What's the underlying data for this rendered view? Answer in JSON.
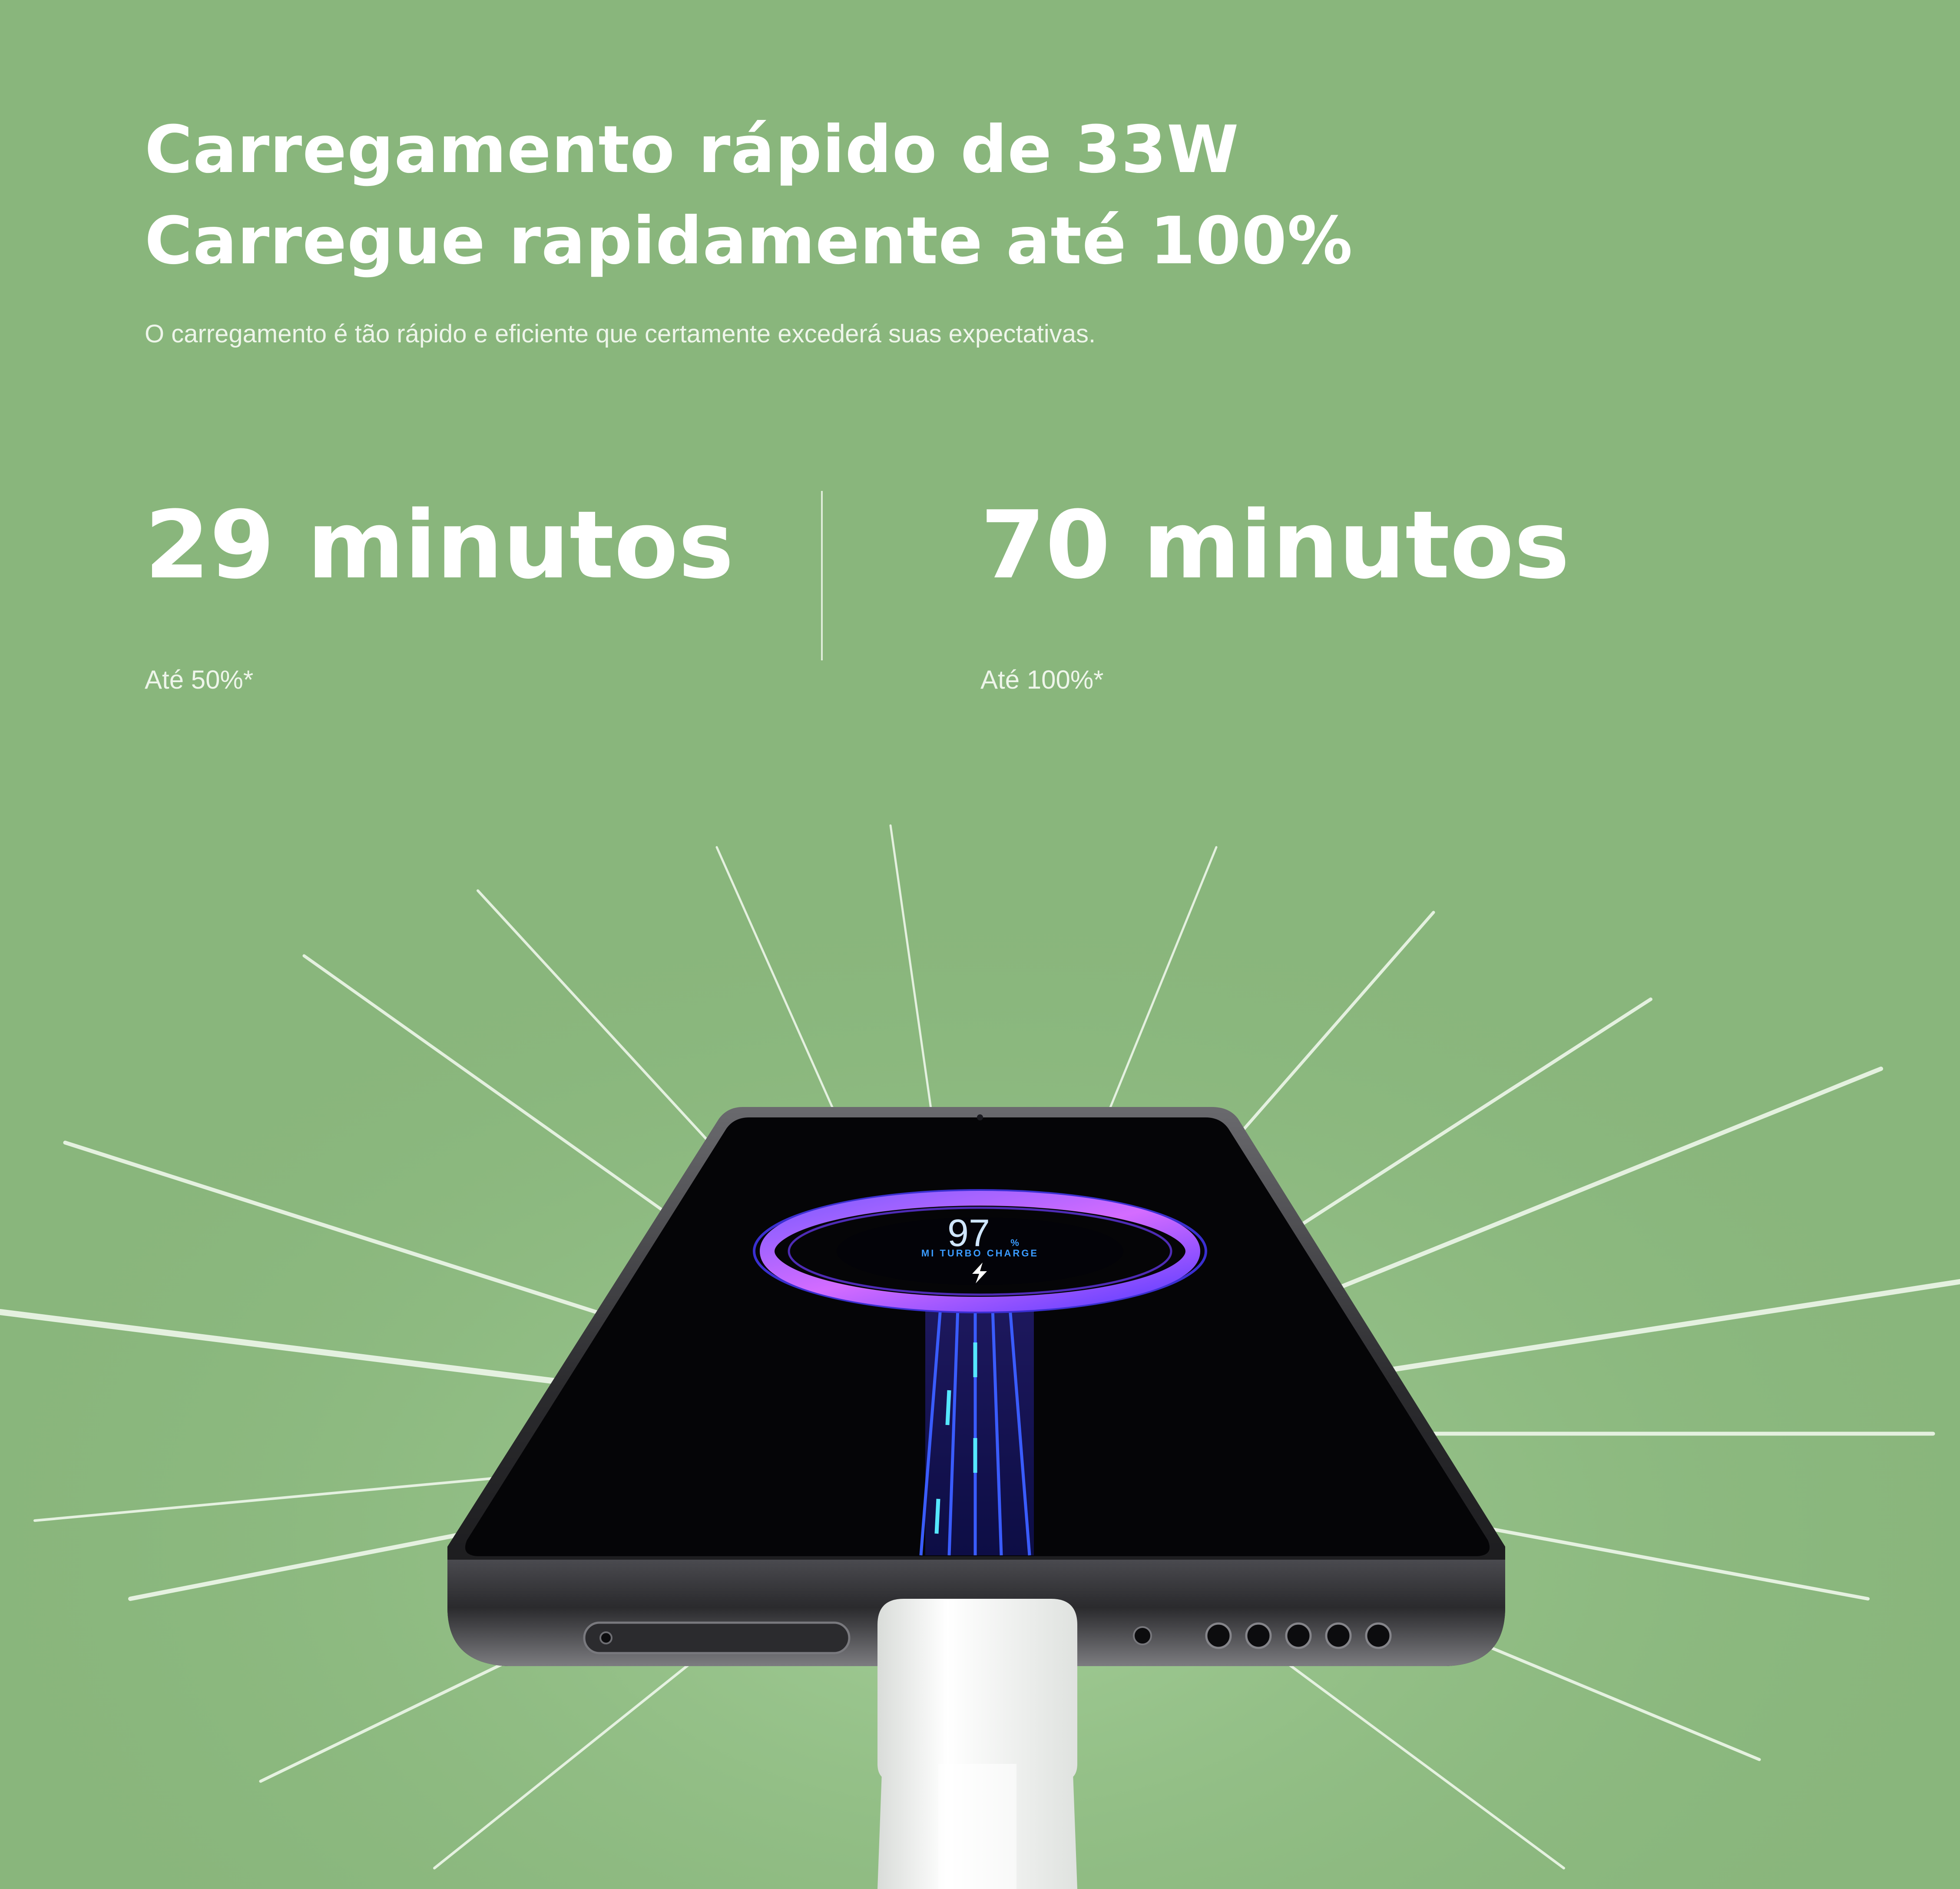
{
  "colors": {
    "background": "#89b67c",
    "text": "#ffffff",
    "subtext": "#eef5ea",
    "screen_ring": "#b35cff",
    "screen_accent": "#3a9bff"
  },
  "header": {
    "title_line1": "Carregamento rápido de 33W",
    "title_line2": "Carregue rapidamente até 100%",
    "description": "O carregamento é tão rápido e eficiente que certamente excederá suas expectativas."
  },
  "stats": [
    {
      "value": "29 minutos",
      "note": "Até 50%*"
    },
    {
      "value": "70 minutos",
      "note": "Até 100%*"
    }
  ],
  "phone": {
    "battery_percent": "97",
    "percent_sign": "%",
    "charge_label": "MI TURBO CHARGE",
    "icon": "lightning-bolt-icon"
  }
}
